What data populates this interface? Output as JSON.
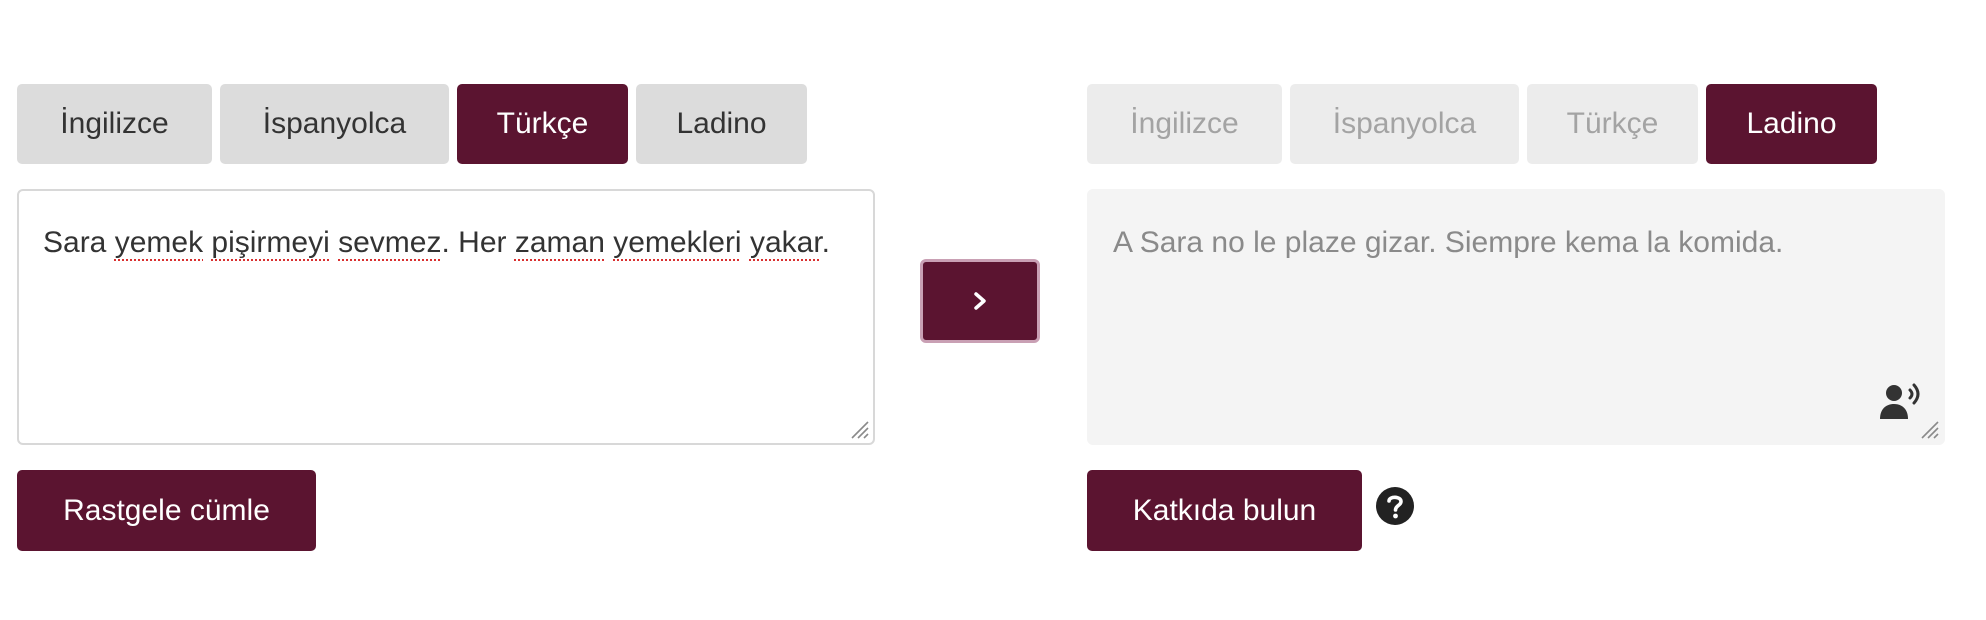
{
  "source": {
    "languages": [
      {
        "label": "İngilizce",
        "state": "default"
      },
      {
        "label": "İspanyolca",
        "state": "default"
      },
      {
        "label": "Türkçe",
        "state": "active"
      },
      {
        "label": "Ladino",
        "state": "default"
      }
    ],
    "text_words": [
      "Sara",
      " ",
      "yemek",
      " ",
      "pişirmeyi",
      " ",
      "sevmez",
      ". Her ",
      "zaman",
      " ",
      "yemekleri",
      " ",
      "yakar",
      "."
    ],
    "random_label": "Rastgele cümle"
  },
  "target": {
    "languages": [
      {
        "label": "İngilizce",
        "state": "muted"
      },
      {
        "label": "İspanyolca",
        "state": "muted"
      },
      {
        "label": "Türkçe",
        "state": "muted"
      },
      {
        "label": "Ladino",
        "state": "active"
      }
    ],
    "text": "A Sara no le plaze gizar. Siempre kema la komida.",
    "contribute_label": "Katkıda bulun"
  },
  "icons": {
    "translate": "chevron-right-icon",
    "help": "question-circle-icon",
    "speak": "speaker-person-icon"
  },
  "colors": {
    "accent": "#5b1430",
    "tab_default": "#dcdcdc",
    "tab_muted": "#ececec",
    "spell_underline": "#d93030"
  }
}
